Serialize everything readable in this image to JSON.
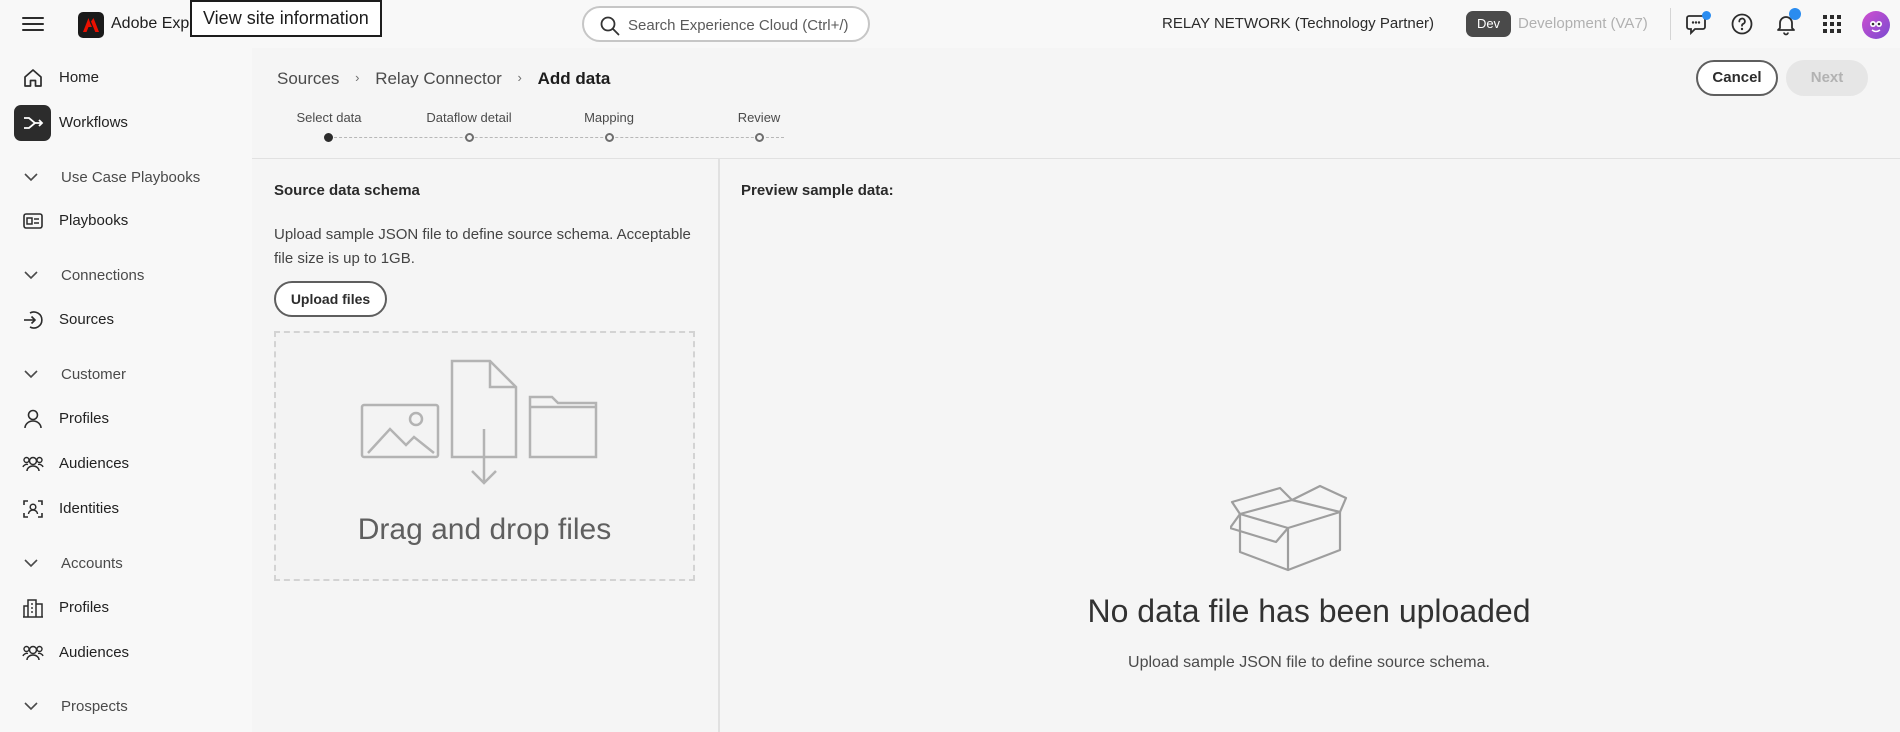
{
  "topbar": {
    "app_name": "Adobe Experience Platform",
    "tooltip": "View site information",
    "search_placeholder": "Search Experience Cloud (Ctrl+/)",
    "org_name": "RELAY NETWORK (Technology Partner)",
    "sandbox_badge": "Dev",
    "sandbox_name": "Development (VA7)"
  },
  "sidebar": {
    "home": "Home",
    "workflows": "Workflows",
    "groups": {
      "use_case": "Use Case Playbooks",
      "connections": "Connections",
      "customer": "Customer",
      "accounts": "Accounts",
      "prospects": "Prospects"
    },
    "playbooks": "Playbooks",
    "sources": "Sources",
    "customer_profiles": "Profiles",
    "customer_audiences": "Audiences",
    "identities": "Identities",
    "account_profiles": "Profiles",
    "account_audiences": "Audiences"
  },
  "breadcrumb": {
    "item1": "Sources",
    "item2": "Relay Connector",
    "current": "Add data",
    "sep": "›"
  },
  "actions": {
    "cancel": "Cancel",
    "next": "Next"
  },
  "steps": [
    "Select data",
    "Dataflow detail",
    "Mapping",
    "Review"
  ],
  "left_panel": {
    "title": "Source data schema",
    "description": "Upload sample JSON file to define source schema. Acceptable file size is up to 1GB.",
    "upload_button": "Upload files",
    "dropzone_text": "Drag and drop files"
  },
  "right_panel": {
    "title": "Preview sample data:",
    "empty_title": "No data file has been uploaded",
    "empty_subtitle": "Upload sample JSON file to define source schema."
  },
  "colors": {
    "notification_dot": "#2a8cf0",
    "active_nav": "#2c2c2c"
  }
}
